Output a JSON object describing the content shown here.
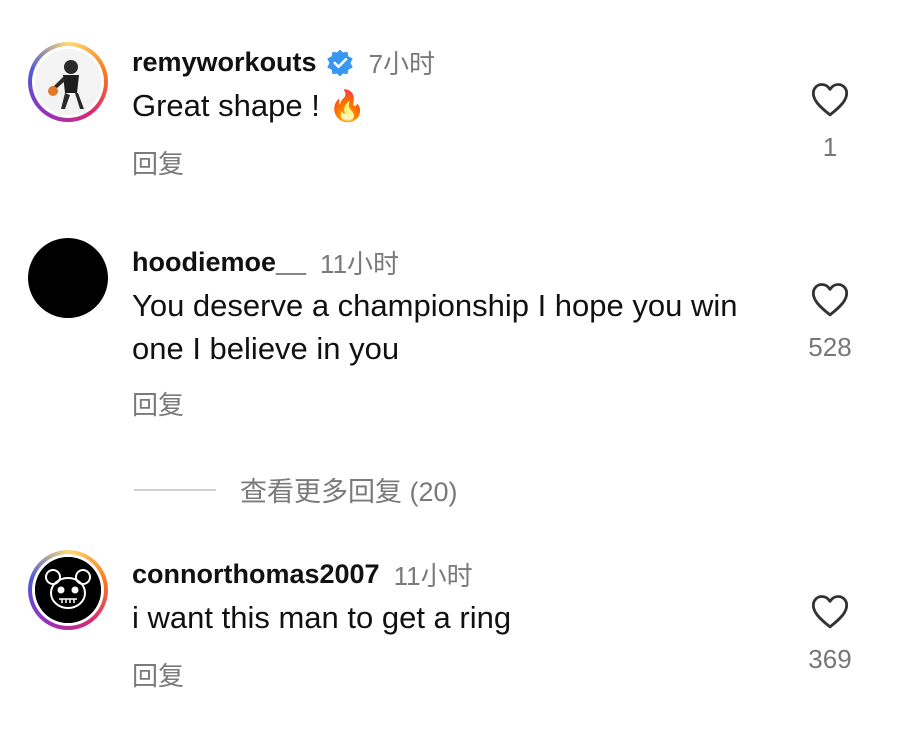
{
  "comments": [
    {
      "username": "remyworkouts",
      "verified": true,
      "time": "7小时",
      "text": "Great shape !",
      "emoji": "🔥",
      "reply_label": "回复",
      "likes": "1"
    },
    {
      "username": "hoodiemoe__",
      "verified": false,
      "time": "11小时",
      "text": "You deserve a championship I hope you win one I believe in you",
      "reply_label": "回复",
      "likes": "528"
    },
    {
      "username": "connorthomas2007",
      "verified": false,
      "time": "11小时",
      "text": "i want this man to get a ring",
      "reply_label": "回复",
      "likes": "369"
    }
  ],
  "view_more": "查看更多回复 (20)",
  "colors": {
    "verified": "#3897f0",
    "secondary_text": "#7a7a7a",
    "fire": "#ff6a00"
  }
}
